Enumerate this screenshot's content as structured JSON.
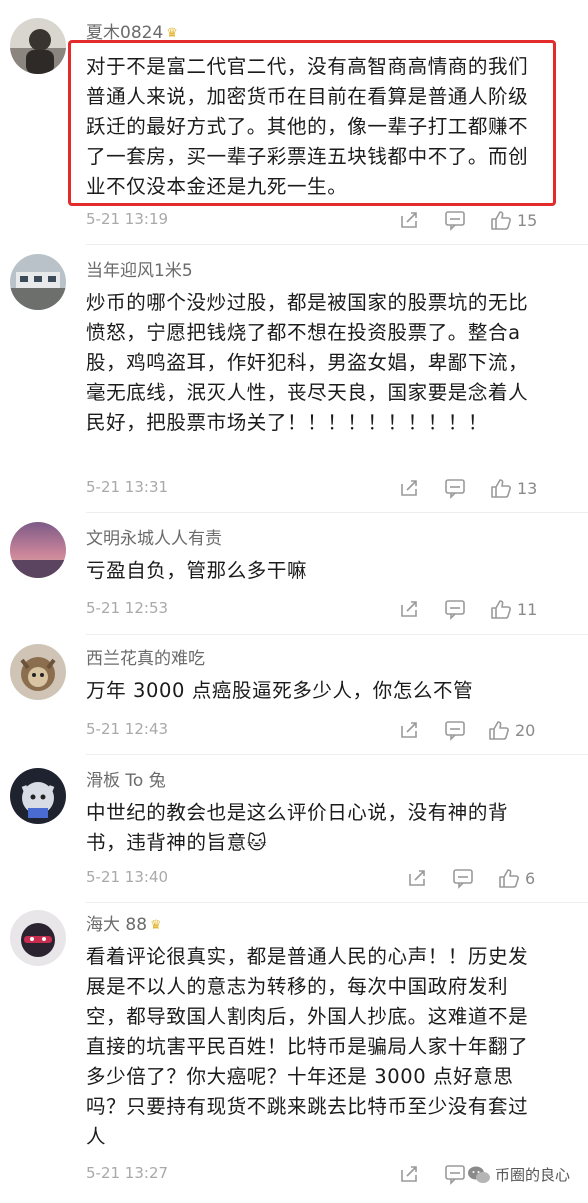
{
  "comments": [
    {
      "username": "夏木0824",
      "crown": true,
      "text": "对于不是富二代官二代，没有高智商高情商的我们普通人来说，加密货币在目前在看算是普通人阶级跃迁的最好方式了。其他的，像一辈子打工都赚不了一套房，买一辈子彩票连五块钱都中不了。而创业不仅没本金还是九死一生。",
      "time": "5-21 13:19",
      "likes": "15"
    },
    {
      "username": "当年迎风1米5",
      "crown": false,
      "text": "炒币的哪个没炒过股，都是被国家的股票坑的无比愤怒，宁愿把钱烧了都不想在投资股票了。整合a股，鸡鸣盗耳，作奸犯科，男盗女娼，卑鄙下流，毫无底线，泯灭人性，丧尽天良，国家要是念着人民好，把股票市场关了！！！！！！！！！！",
      "time": "5-21 13:31",
      "likes": "13"
    },
    {
      "username": "文明永城人人有责",
      "crown": false,
      "text": "亏盈自负，管那么多干嘛",
      "time": "5-21 12:53",
      "likes": "11"
    },
    {
      "username": "西兰花真的难吃",
      "crown": false,
      "text": "万年 3000 点癌股逼死多少人，你怎么不管",
      "time": "5-21 12:43",
      "likes": "20"
    },
    {
      "username": "滑板 To 兔",
      "crown": false,
      "text": "中世纪的教会也是这么评价日心说，没有神的背书，违背神的旨意",
      "emoji": "🐱",
      "time": "5-21 13:40",
      "likes": "6"
    },
    {
      "username": "海大 88",
      "crown": true,
      "text": "看着评论很真实，都是普通人民的心声！！历史发展是不以人的意志为转移的，每次中国政府发利空，都导致国人割肉后，外国人抄底。这难道不是直接的坑害平民百姓！比特币是骗局人家十年翻了多少倍了？你大癌呢？十年还是 3000 点好意思吗？只要持有现货不跳来跳去比特币至少没有套过人",
      "time": "5-21 13:27",
      "likes": ""
    }
  ],
  "watermark": "币圈的良心",
  "colors": {
    "highlight": "#e32b2b",
    "crown": "#e3b52e"
  },
  "icons": [
    "crown-icon",
    "share-icon",
    "comment-icon",
    "like-icon",
    "wechat-icon"
  ]
}
